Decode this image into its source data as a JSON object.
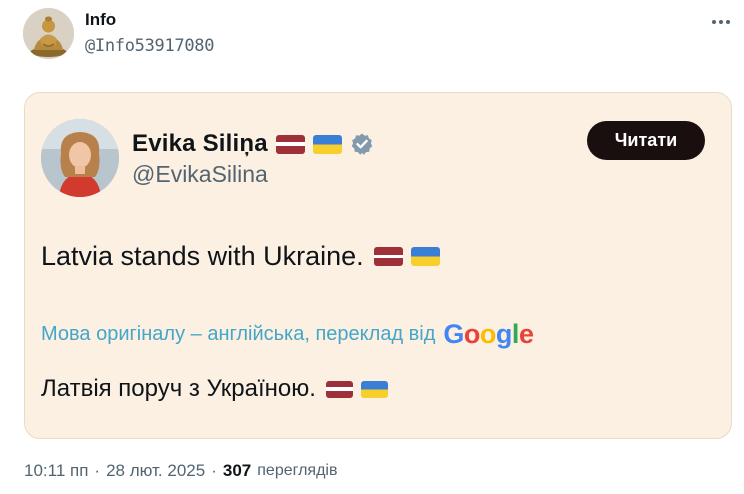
{
  "author": {
    "name": "Info",
    "handle": "@Info53917080",
    "avatar_icon": "buddha-statue-avatar"
  },
  "menu": {
    "icon": "more-options-icon"
  },
  "quoted_post": {
    "name": "Evika Siliņa",
    "handle": "@EvikaSilina",
    "verified_icon": "verified-badge-icon",
    "name_flags": [
      "latvia-flag",
      "ukraine-flag"
    ],
    "follow_label": "Читати",
    "text": "Latvia stands with Ukraine.",
    "text_flags": [
      "latvia-flag",
      "ukraine-flag"
    ],
    "translation_note": "Мова оригіналу – англійська, переклад від",
    "translation_provider": [
      "G",
      "o",
      "o",
      "g",
      "l",
      "e"
    ],
    "translated_text": "Латвія поруч з Україною.",
    "translated_flags": [
      "latvia-flag",
      "ukraine-flag"
    ]
  },
  "meta": {
    "time": "10:11 пп",
    "date": "28 лют. 2025",
    "separator": "·",
    "views_count": "307",
    "views_label": "переглядів"
  },
  "colors": {
    "card_bg": "#fcf0e3",
    "follow_bg": "#1a0f0f",
    "translation_link": "#44a6c8",
    "secondary_text": "#536471"
  }
}
